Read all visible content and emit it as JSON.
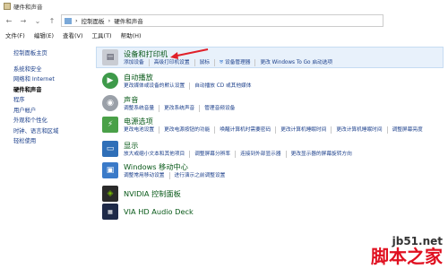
{
  "window": {
    "title": "硬件和声音"
  },
  "nav": {
    "breadcrumb_root": "控制面板",
    "breadcrumb_sep": "›",
    "breadcrumb_current": "硬件和声音"
  },
  "menu": [
    "文件(F)",
    "编辑(E)",
    "查看(V)",
    "工具(T)",
    "帮助(H)"
  ],
  "sidebar": {
    "home": "控制面板主页",
    "items": [
      "系统和安全",
      "网络和 Internet",
      "硬件和声音",
      "程序",
      "用户帐户",
      "外观和个性化",
      "时钟、语言和区域",
      "轻松使用"
    ],
    "current": "硬件和声音"
  },
  "categories": [
    {
      "title": "设备和打印机",
      "icon": "printer-icon",
      "links": [
        "添加设备",
        "高级打印机设置",
        "鼠标",
        "设备管理器",
        "更改 Windows To Go 启动选项"
      ]
    },
    {
      "title": "自动播放",
      "icon": "autoplay-icon",
      "links": [
        "更改媒体或设备的默认设置",
        "自动播放 CD 或其他媒体"
      ]
    },
    {
      "title": "声音",
      "icon": "speaker-icon",
      "links": [
        "调整系统音量",
        "更改系统声音",
        "管理音频设备"
      ]
    },
    {
      "title": "电源选项",
      "icon": "power-icon",
      "links": [
        "更改电池设置",
        "更改电源按钮的功能",
        "唤醒计算机时需要密码",
        "更改计算机睡眠时间",
        "更改计算机睡眠时间",
        "调整屏幕亮度"
      ]
    },
    {
      "title": "显示",
      "icon": "display-icon",
      "links": [
        "放大或缩小文本和其他项目",
        "调整屏幕分辨率",
        "连接到外部显示器",
        "更改显示器的屏幕旋转方向"
      ]
    },
    {
      "title": "Windows 移动中心",
      "icon": "mobility-center-icon",
      "links": [
        "调整常用移动设置",
        "进行演示之前调整设置"
      ]
    },
    {
      "title": "NVIDIA 控制面板",
      "icon": "nvidia-icon",
      "links": []
    },
    {
      "title": "VIA HD Audio Deck",
      "icon": "via-audio-icon",
      "links": []
    }
  ],
  "watermark": {
    "line1": "jb51.net",
    "line2": "脚本之家"
  },
  "colors": {
    "link": "#1a3e8a",
    "heading": "#0a5a1a",
    "arrow": "#e0202a",
    "selection": "#e8f1fb"
  }
}
